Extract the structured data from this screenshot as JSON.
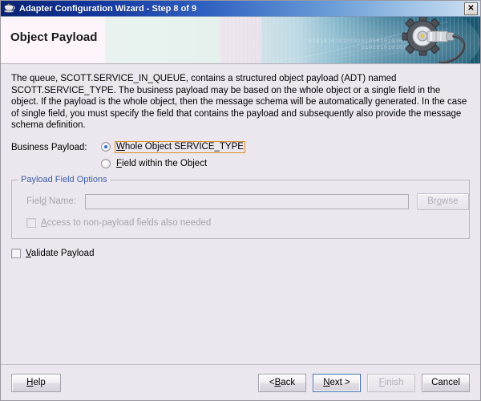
{
  "window": {
    "title": "Adapter Configuration Wizard - Step 8 of 9",
    "icon": "java-coffee-cup-icon",
    "close_label": "✕"
  },
  "banner": {
    "title": "Object Payload",
    "binary_line1": "01010101010101010101010101",
    "binary_line2": "010101010101",
    "graphic": "gear-wrench-icon"
  },
  "main": {
    "description": "The queue, SCOTT.SERVICE_IN_QUEUE, contains a structured object payload (ADT) named SCOTT.SERVICE_TYPE. The business payload may be based on the whole object or a single field in the object. If the payload is the whole object, then the message schema will be automatically generated. In the case of single field, you must specify the field that contains the payload and subsequently also provide the message schema definition.",
    "business_payload_label": "Business Payload:",
    "radios": [
      {
        "label": "Whole Object SERVICE_TYPE",
        "mnemonic": "W",
        "selected": true,
        "focused": true
      },
      {
        "label": "Field within the Object",
        "mnemonic": "F",
        "selected": false,
        "focused": false
      }
    ],
    "group": {
      "legend": "Payload Field Options",
      "field_label": "Field Name:",
      "field_mnemonic": "d",
      "field_value": "",
      "field_placeholder": "",
      "browse_label": "Browse",
      "browse_mnemonic": "o",
      "checkbox_label": "Access to non-payload fields also needed",
      "checkbox_mnemonic": "A",
      "checkbox_checked": false,
      "enabled": false
    },
    "validate": {
      "label": "Validate Payload",
      "mnemonic": "V",
      "checked": false
    }
  },
  "footer": {
    "help_label": "Help",
    "help_mnemonic": "H",
    "back_label": "< Back",
    "back_mnemonic": "B",
    "next_label": "Next >",
    "next_mnemonic": "N",
    "finish_label": "Finish",
    "finish_mnemonic": "F",
    "finish_enabled": false,
    "cancel_label": "Cancel"
  },
  "colors": {
    "dialog_bg": "#ece7ee",
    "title_start": "#0a2472",
    "title_end": "#cfe0f1",
    "legend_blue": "#3a5fa8",
    "focus_orange": "#d98f22",
    "default_button_blue": "#3f6fb5",
    "disabled_text": "#a9a3ad"
  }
}
